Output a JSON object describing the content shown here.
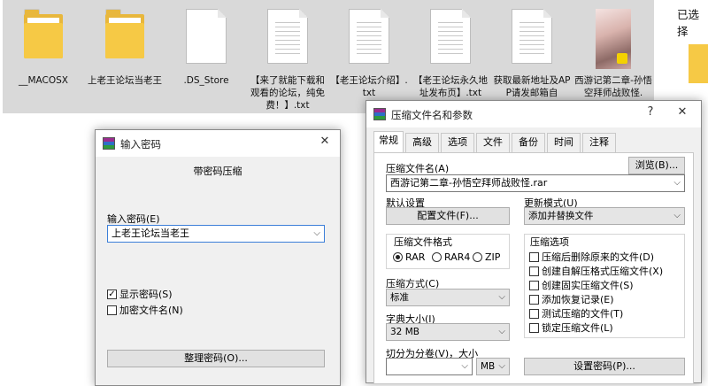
{
  "explorer": {
    "files": [
      {
        "name": "__MACOSX",
        "kind": "folder"
      },
      {
        "name": "上老王论坛当老王",
        "kind": "folder"
      },
      {
        "name": ".DS_Store",
        "kind": "blank"
      },
      {
        "name": "【来了就能下载和观看的论坛，纯免费！】.txt",
        "kind": "text"
      },
      {
        "name": "【老王论坛介绍】.txt",
        "kind": "text"
      },
      {
        "name": "【老王论坛永久地址发布页】.txt",
        "kind": "text"
      },
      {
        "name": "获取最新地址及APP请发邮箱自",
        "kind": "text"
      },
      {
        "name": "西游记第二章-孙悟空拜师战败怪.",
        "kind": "video"
      }
    ],
    "selected_label": "已选择"
  },
  "password_dialog": {
    "title": "输入密码",
    "heading": "带密码压缩",
    "password_label": "输入密码(E)",
    "password_value": "上老王论坛当老王",
    "show_password": "显示密码(S)",
    "encrypt_names": "加密文件名(N)",
    "manage_button": "整理密码(O)..."
  },
  "archive_dialog": {
    "title": "压缩文件名和参数",
    "help": "?",
    "close": "✕",
    "tabs": [
      "常规",
      "高级",
      "选项",
      "文件",
      "备份",
      "时间",
      "注释"
    ],
    "archive_name_label": "压缩文件名(A)",
    "browse_button": "浏览(B)...",
    "archive_name_value": "西游记第二章-孙悟空拜师战败怪.rar",
    "default_settings_label": "默认设置",
    "profiles_button": "配置文件(F)...",
    "update_mode_label": "更新模式(U)",
    "update_mode_value": "添加并替换文件",
    "format_label": "压缩文件格式",
    "formats": [
      "RAR",
      "RAR4",
      "ZIP"
    ],
    "method_label": "压缩方式(C)",
    "method_value": "标准",
    "dict_label": "字典大小(I)",
    "dict_value": "32 MB",
    "split_label": "切分为分卷(V)，大小",
    "split_unit": "MB",
    "options_label": "压缩选项",
    "options": [
      "压缩后删除原来的文件(D)",
      "创建自解压格式压缩文件(X)",
      "创建固实压缩文件(S)",
      "添加恢复记录(E)",
      "测试压缩的文件(T)",
      "锁定压缩文件(L)"
    ],
    "set_password_button": "设置密码(P)..."
  }
}
